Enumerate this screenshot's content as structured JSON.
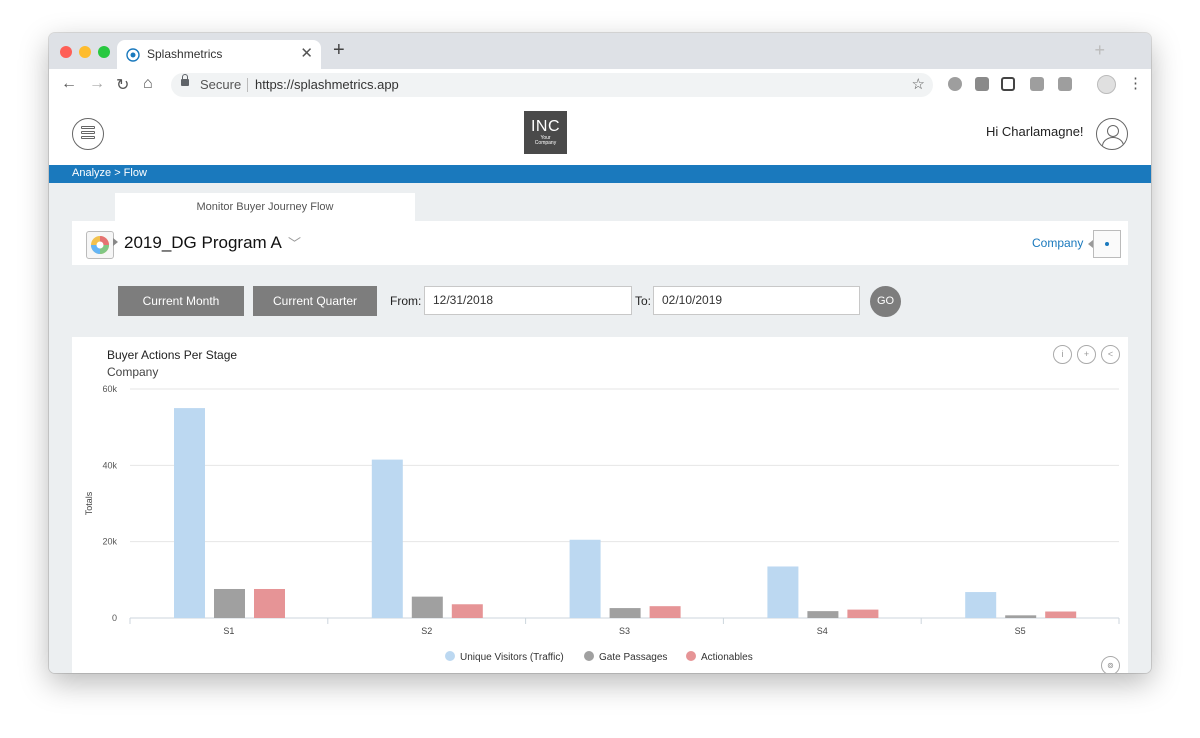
{
  "browser": {
    "tab_title": "Splashmetrics",
    "new_tab": "+",
    "close": "✕",
    "secure_label": "Secure",
    "url": "https://splashmetrics.app"
  },
  "header": {
    "logo_main": "INC",
    "logo_sub_1": "Your",
    "logo_sub_2": "Company",
    "greeting": "Hi Charlamagne!"
  },
  "breadcrumb": "Analyze > Flow",
  "page_tab": "Monitor Buyer Journey Flow",
  "program": {
    "name": "2019_DG Program A",
    "chevron": "﹀",
    "company_link": "Company"
  },
  "filters": {
    "current_month": "Current Month",
    "current_quarter": "Current Quarter",
    "from_label": "From:",
    "from_value": "12/31/2018",
    "to_label": "To:",
    "to_value": "02/10/2019",
    "go": "GO"
  },
  "colors": {
    "brand_blue": "#1a79bd",
    "unique_visitors": "#bcd8f1",
    "gate_passages": "#a0a0a0",
    "actionables": "#e69496"
  },
  "chart_data": {
    "type": "bar",
    "title": "Buyer Actions Per Stage",
    "subtitle": "Company",
    "ylabel": "Totals",
    "xlabel": "",
    "categories": [
      "S1",
      "S2",
      "S3",
      "S4",
      "S5"
    ],
    "ylim": [
      0,
      60000
    ],
    "yticks": [
      0,
      20000,
      40000,
      60000
    ],
    "ytick_labels": [
      "0",
      "20k",
      "40k",
      "60k"
    ],
    "grid": true,
    "legend": "bottom-center",
    "series": [
      {
        "name": "Unique Visitors (Traffic)",
        "color": "#bcd8f1",
        "values": [
          55000,
          41500,
          20500,
          13500,
          6800
        ]
      },
      {
        "name": "Gate Passages",
        "color": "#a0a0a0",
        "values": [
          7600,
          5600,
          2600,
          1800,
          700
        ]
      },
      {
        "name": "Actionables",
        "color": "#e69496",
        "values": [
          7600,
          3600,
          3100,
          2200,
          1700
        ]
      }
    ]
  }
}
